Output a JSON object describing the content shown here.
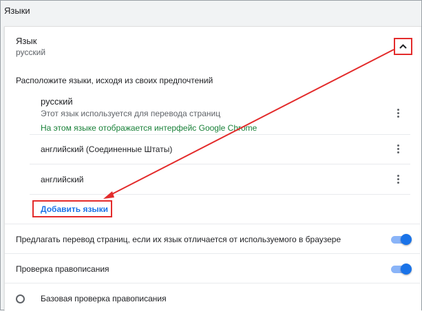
{
  "section": {
    "title": "Языки"
  },
  "language": {
    "heading": "Язык",
    "current": "русский"
  },
  "order": {
    "label": "Расположите языки, исходя из своих предпочтений",
    "items": [
      {
        "name": "русский",
        "note1": "Этот язык используется для перевода страниц",
        "note2": "На этом языке отображается интерфейс Google Chrome"
      },
      {
        "name": "английский (Соединенные Штаты)"
      },
      {
        "name": "английский"
      }
    ],
    "add_label": "Добавить языки"
  },
  "offer_translate": {
    "label": "Предлагать перевод страниц, если их язык отличается от используемого в браузере",
    "enabled": true
  },
  "spellcheck": {
    "label": "Проверка правописания",
    "enabled": true,
    "basic_label": "Базовая проверка правописания"
  },
  "colors": {
    "accent": "#1a73e8",
    "annotation": "#e32b2b",
    "interface_note": "#188038"
  }
}
